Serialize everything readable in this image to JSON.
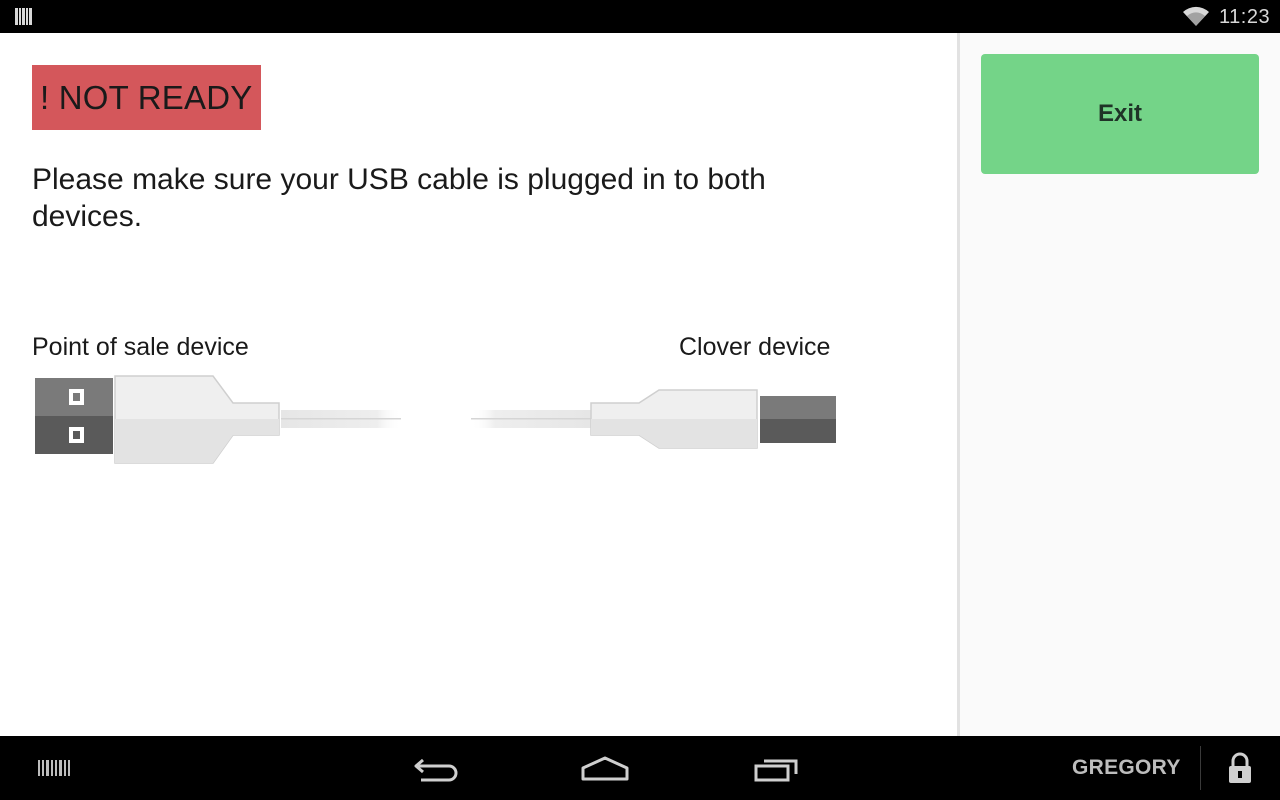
{
  "status_bar": {
    "notification_icon": "barcode-notification-icon",
    "wifi_icon": "wifi-icon",
    "time": "11:23"
  },
  "main": {
    "status_badge": "! NOT READY",
    "message": "Please make sure your USB cable is plugged in to both devices.",
    "left_device_label": "Point of sale device",
    "right_device_label": "Clover device",
    "illustration": "usb-cable-illustration"
  },
  "side": {
    "exit_label": "Exit"
  },
  "nav_bar": {
    "icons": [
      "barcode-icon",
      "back-icon",
      "home-icon",
      "recents-icon",
      "lock-icon"
    ],
    "employee_name": "GREGORY"
  },
  "colors": {
    "status_badge_bg": "#d4575b",
    "exit_button_bg": "#74d488",
    "bar_bg": "#000000",
    "side_bg": "#fafafa"
  }
}
